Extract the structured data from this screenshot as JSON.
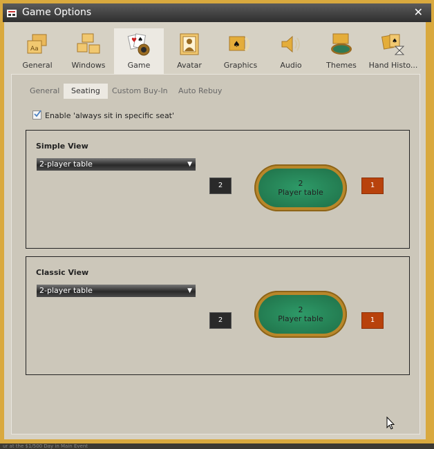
{
  "window": {
    "title": "Game Options",
    "close_label": "✕"
  },
  "toolbar": {
    "items": [
      {
        "label": "General",
        "icon": "general-icon"
      },
      {
        "label": "Windows",
        "icon": "windows-icon"
      },
      {
        "label": "Game",
        "icon": "game-icon",
        "active": true
      },
      {
        "label": "Avatar",
        "icon": "avatar-icon"
      },
      {
        "label": "Graphics",
        "icon": "graphics-icon"
      },
      {
        "label": "Audio",
        "icon": "audio-icon"
      },
      {
        "label": "Themes",
        "icon": "themes-icon"
      },
      {
        "label": "Hand Histo...",
        "icon": "hand-history-icon"
      }
    ]
  },
  "subtabs": [
    {
      "label": "General"
    },
    {
      "label": "Seating",
      "active": true
    },
    {
      "label": "Custom Buy-In"
    },
    {
      "label": "Auto Rebuy"
    }
  ],
  "seating": {
    "sit_specific_label": "Enable 'always sit in specific seat'",
    "sit_specific_checked": true,
    "simple": {
      "title": "Simple View",
      "dropdown": "2-player table",
      "seat_left": "2",
      "seat_right": "1",
      "table_count": "2",
      "table_label": "Player table"
    },
    "classic": {
      "title": "Classic View",
      "dropdown": "2-player table",
      "seat_left": "2",
      "seat_right": "1",
      "table_count": "2",
      "table_label": "Player table"
    }
  },
  "background_text": "ur at the $1/500 Day in Main Event",
  "colors": {
    "accent": "#d9a93e",
    "felt": "#1f7048",
    "seat_active": "#b8420c"
  }
}
